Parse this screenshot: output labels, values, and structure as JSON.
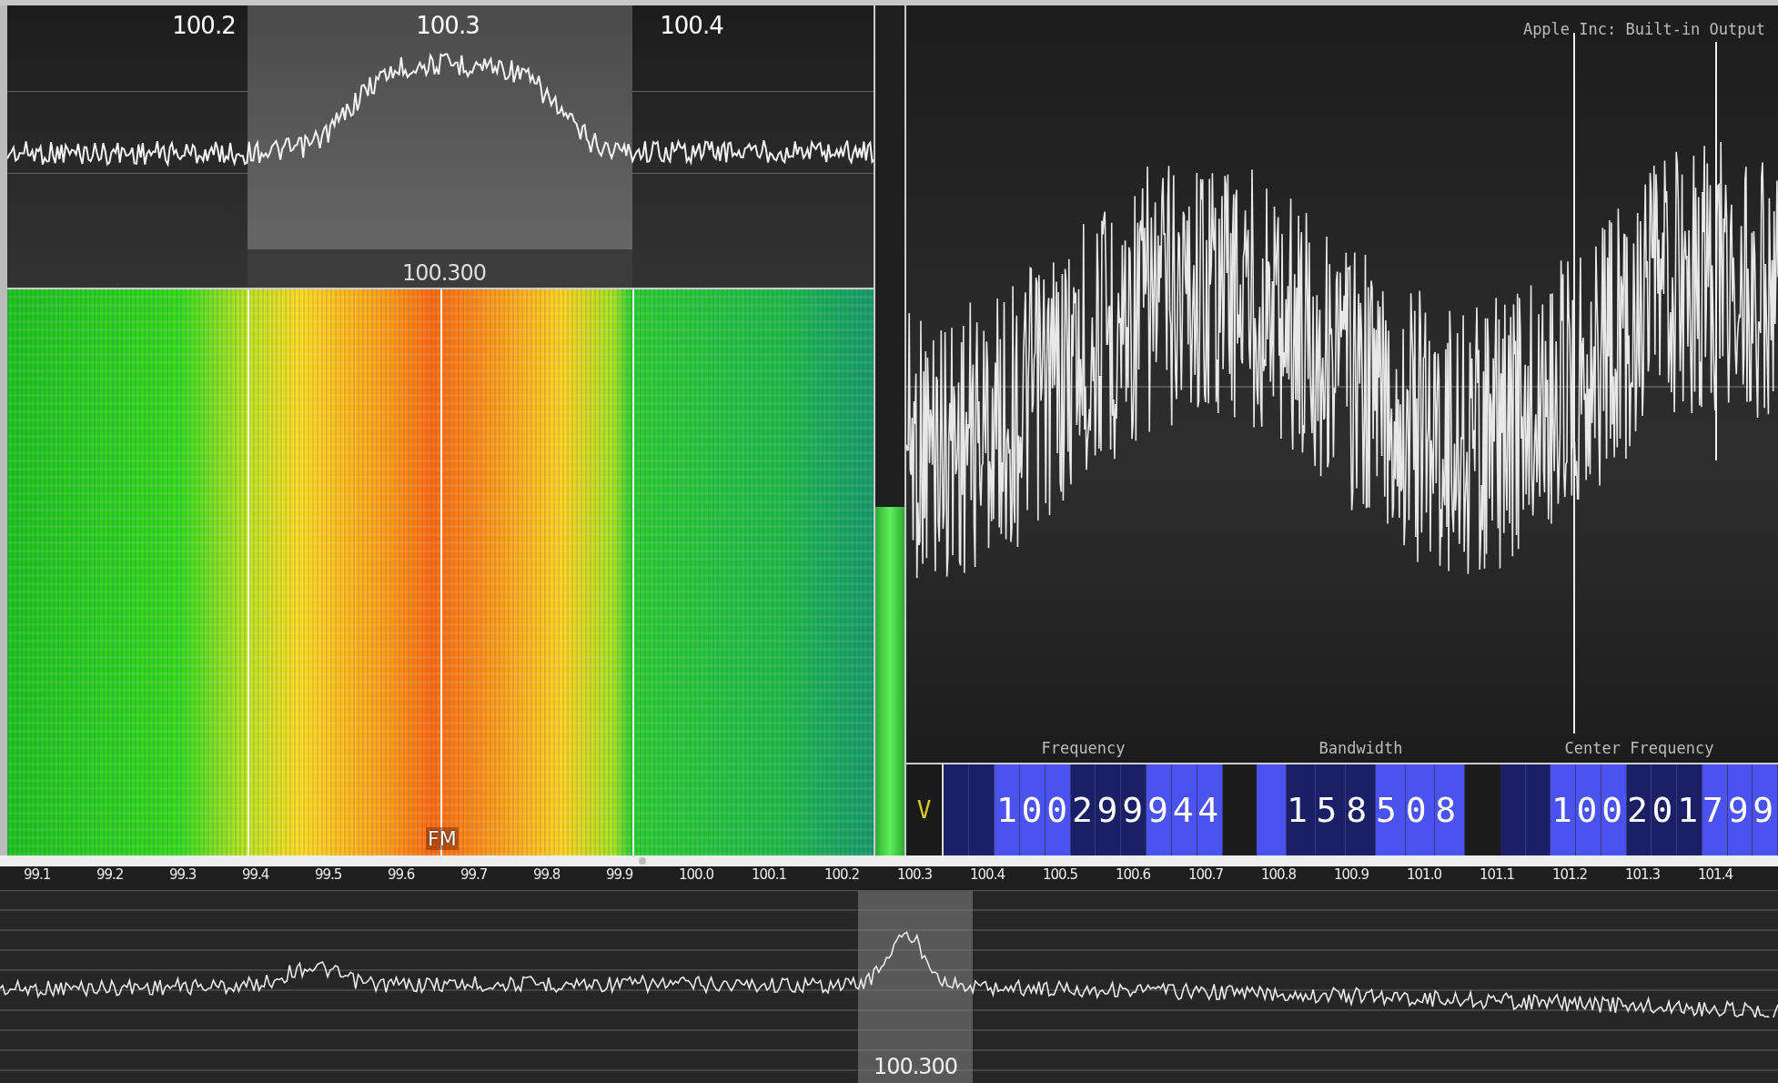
{
  "spectrum": {
    "scale_labels": [
      "100.2",
      "100.3",
      "100.4"
    ],
    "center_label": "100.300"
  },
  "waterfall": {
    "mode_label": "FM"
  },
  "level_meter": {
    "level": 0.41
  },
  "scope": {
    "device_label": "Apple Inc: Built-in Output"
  },
  "controls": [
    {
      "kind": "toggle",
      "label": "V"
    },
    {
      "kind": "readout",
      "caption": "Frequency",
      "value": "100299944"
    },
    {
      "kind": "readout",
      "caption": "Bandwidth",
      "value": "158508"
    },
    {
      "kind": "readout",
      "caption": "Center Frequency",
      "value": "100201799"
    }
  ],
  "overview": {
    "scale_labels": [
      "99.1",
      "99.2",
      "99.3",
      "99.4",
      "99.5",
      "99.6",
      "99.7",
      "99.8",
      "99.9",
      "100.0",
      "100.1",
      "100.2",
      "100.3",
      "100.4",
      "100.5",
      "100.6",
      "100.7",
      "100.8",
      "100.9",
      "101.0",
      "101.1",
      "101.2",
      "101.3",
      "101.4"
    ],
    "center_label": "100.300"
  }
}
